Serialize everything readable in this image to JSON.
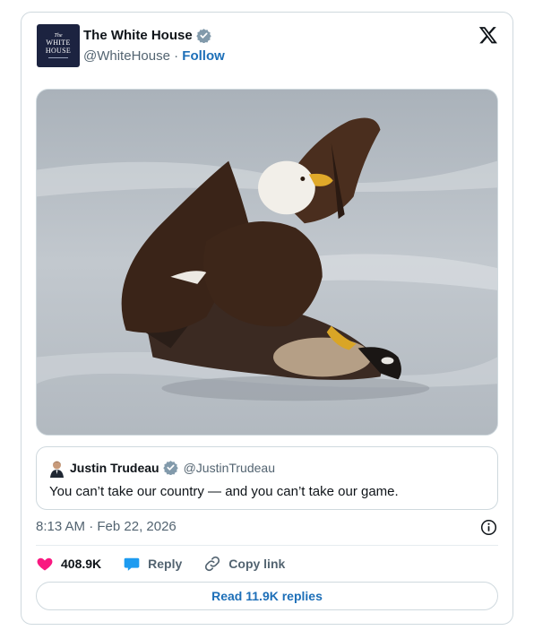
{
  "author": {
    "avatar_lines": [
      "The",
      "WHITE",
      "HOUSE"
    ],
    "name": "The White House",
    "handle": "@WhiteHouse",
    "separator": "·",
    "follow_label": "Follow"
  },
  "media": {
    "icon": "bald-eagle-photo"
  },
  "quote": {
    "name": "Justin Trudeau",
    "handle": "@JustinTrudeau",
    "text": "You can’t take our country — and you can’t take our game."
  },
  "meta": {
    "timestamp": "8:13 AM · Feb 22, 2026"
  },
  "actions": {
    "likes": "408.9K",
    "reply_label": "Reply",
    "copy_link_label": "Copy link"
  },
  "read_replies_label": "Read 11.9K replies",
  "colors": {
    "link": "#1d6fb8",
    "verified_gray": "#829aab",
    "like_pink": "#f91880",
    "reply_blue": "#1d9bf0"
  }
}
